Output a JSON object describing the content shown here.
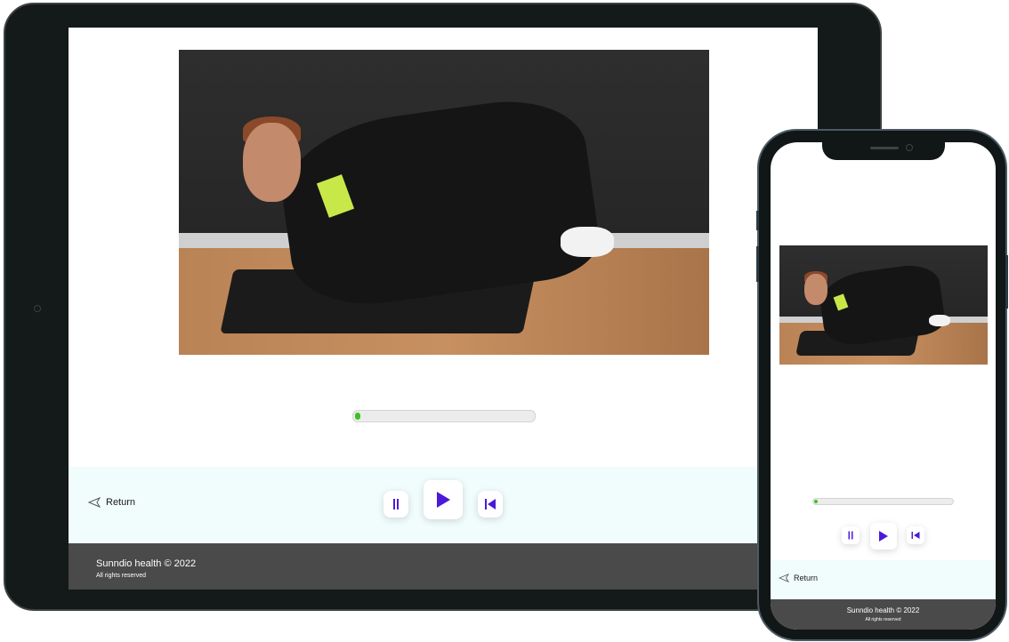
{
  "tablet": {
    "return_label": "Return",
    "footer": {
      "company": "Sunndio health",
      "copyright_symbol": "©",
      "year": "2022",
      "rights": "All rights reserved"
    },
    "progress": 0.02
  },
  "phone": {
    "return_label": "Return",
    "footer": {
      "company": "Sunndio health",
      "copyright_symbol": "©",
      "year": "2022",
      "rights": "All rights reserved"
    },
    "progress": 0.02
  },
  "icons": {
    "pause": "pause-icon",
    "play": "play-icon",
    "restart": "skip-back-icon",
    "return": "return-arrow-icon"
  },
  "colors": {
    "accent": "#4a1ad8",
    "progress": "#3ec21f",
    "control_bg": "#f1fcfc",
    "footer_bg": "#4a4a4a"
  }
}
